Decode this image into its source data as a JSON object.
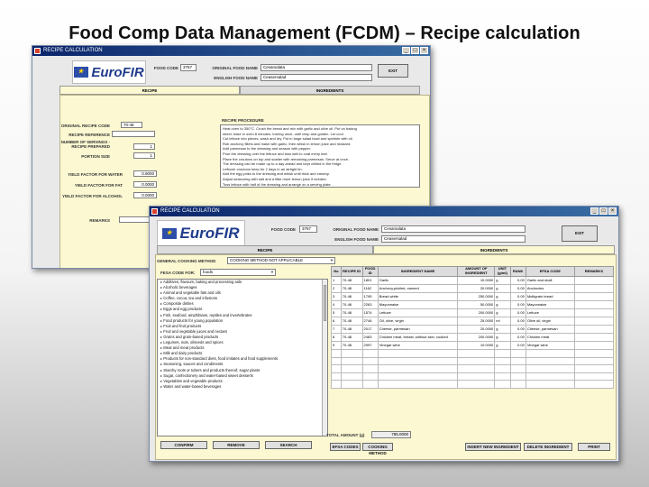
{
  "slide": {
    "title": "Food Comp Data Management (FCDM) – Recipe calculation"
  },
  "logo": {
    "text": "EuroFIR"
  },
  "back_window": {
    "title": "RECIPE CALCULATION",
    "food_code_label": "FOOD CODE",
    "food_code": "3767",
    "original_food_name_label": "ORIGINAL FOOD NAME",
    "original_food_name": "Cesarsalata",
    "english_food_name_label": "ENGLISH FOOD NAME",
    "english_food_name": "Ceasersalad",
    "exit_label": "EXIT",
    "tabs": [
      "RECIPE",
      "INGREDIENTS"
    ],
    "fields": [
      {
        "label": "ORIGINAL RECIPE CODE",
        "value": "70-48"
      },
      {
        "label": "RECIPE REFERENCE",
        "value": ""
      },
      {
        "label": "NUMBER OF SERVINGS - RECIPE PREPARED",
        "value": "1"
      },
      {
        "label": "PORTION SIZE",
        "value": "1"
      },
      {
        "label": "YIELD FACTOR FOR WATER",
        "value": "0.9000"
      },
      {
        "label": "YIELD FACTOR FOR FAT",
        "value": "0.0000"
      },
      {
        "label": "YIELD FACTOR FOR ALCOHOL",
        "value": "0.0000"
      },
      {
        "label": "REMARKS",
        "value": ""
      }
    ],
    "recipe_procedure_label": "RECIPE PROCEDURE",
    "recipe_procedure_lines": [
      "Heat oven to 350°C. Crush the bread and mix with garlic and olive oil. Put on baking",
      "sheet, bake in oven 8 minutes, turning once, until crisp and golden. Let cool.",
      "Cut lettuce into pieces, wash and dry. Put in large salad bowl and sprinkle with oil.",
      "Rub anchovy fillets and mash with garlic, then whisk in lemon juice and mustard.",
      "Add parmesan to the dressing and season with pepper.",
      "Pour the dressing over the lettuce and toss well to coat every leaf.",
      "Place the croutons on top and scatter with remaining parmesan. Serve at once.",
      "The dressing can be made up to a day ahead and kept chilled in the fridge.",
      "Leftover croutons keep for 2 days in an airtight tin.",
      "Add the egg yolks to the dressing and whisk until thick and creamy.",
      "Adjust seasoning with salt and a little more lemon juice if needed.",
      "Toss lettuce with half of the dressing and arrange on a serving plate."
    ]
  },
  "front_window": {
    "title": "RECIPE CALCULATION",
    "food_code_label": "FOOD CODE",
    "food_code": "3767",
    "original_food_name_label": "ORIGINAL FOOD NAME",
    "original_food_name": "Cesarsalata",
    "english_food_name_label": "ENGLISH FOOD NAME",
    "english_food_name": "Ceasersalad",
    "exit_label": "EXIT",
    "tabs": [
      "RECIPE",
      "INGREDIENTS"
    ],
    "general_cooking_method_label": "GENERAL COOKING METHOD",
    "general_cooking_method_value": "COOKING METHOD NOT APPLICABLE",
    "fesa_code_label": "FESA CODE FOR:",
    "fesa_code_value": "foods",
    "categories": [
      "Additives, flavours, baking and processing aids",
      "Alcoholic beverages",
      "Animal and vegetable fats and oils",
      "Coffee, cocoa, tea and infusions",
      "Composite dishes",
      "Eggs and egg products",
      "Fish, seafood, amphibians, reptiles and invertebrates",
      "Food products for young population",
      "Fruit and fruit products",
      "Fruit and vegetable juices and nectars",
      "Grains and grain-based products",
      "Legumes, nuts, oilseeds and spices",
      "Meat and meat products",
      "Milk and dairy products",
      "Products for non-standard diets, food imitates and food supplements",
      "Seasoning, sauces and condiments",
      "Starchy roots or tubers and products thereof, sugar plants",
      "Sugar, confectionery and water-based sweet desserts",
      "Vegetables and vegetable products",
      "Water and water-based beverages"
    ],
    "table_headers": [
      "No",
      "RECIPE ID",
      "FOOD ID",
      "INGREDIENT NAME",
      "AMOUNT OF INGREDIENT",
      "UNIT (g/ml)",
      "RANK",
      "EFSA CODE",
      "REMARKS"
    ],
    "ingredients": [
      [
        "1",
        "70-48",
        "1801",
        "Garlic",
        "10.0000",
        "g",
        "0.00",
        "Garlic and shall",
        ""
      ],
      [
        "2",
        "70-48",
        "1162",
        "Anchovy,pickled, canned",
        "20.0000",
        "g",
        "0.00",
        "Anchovies",
        ""
      ],
      [
        "3",
        "70-48",
        "1795",
        "Bread white",
        "250.0000",
        "g",
        "0.00",
        "Multigrain bread",
        ""
      ],
      [
        "4",
        "70-48",
        "2263",
        "Mayonnaise",
        "50.0000",
        "g",
        "0.00",
        "Mayonnaise",
        ""
      ],
      [
        "5",
        "70-48",
        "1574",
        "Lettuce",
        "200.0000",
        "g",
        "0.00",
        "Lettuce",
        ""
      ],
      [
        "6",
        "70-48",
        "2746",
        "Oil, olive, virgin",
        "25.0000",
        "ml",
        "0.00",
        "Olive oil, virgin",
        ""
      ],
      [
        "7",
        "70-48",
        "2017",
        "Cheese, parmesan",
        "20.0000",
        "g",
        "0.00",
        "Cheese, parmesan",
        ""
      ],
      [
        "8",
        "70-48",
        "2483",
        "Chicken meat, breast, without skin, cooked",
        "200.0000",
        "g",
        "0.00",
        "Chicken meat",
        ""
      ],
      [
        "9",
        "70-48",
        "2997",
        "Vinegar wine",
        "10.0000",
        "g",
        "0.00",
        "Vinegar wine",
        ""
      ]
    ],
    "total_amount_label": "TOTAL AMOUNT (g)",
    "total_amount_value": "785.0000",
    "buttons": {
      "confirm": "CONFIRM",
      "remove": "REMOVE",
      "search": "SEARCH",
      "efsa_codes": "EFSA CODES",
      "cooking_method": "COOKING METHOD",
      "insert_new_ingredient": "INSERT NEW INGREDIENT",
      "delete_ingredient": "DELETE INGREDIENT",
      "print": "PRINT"
    }
  },
  "colors": {
    "titlebar": "#0a246a",
    "panel": "#fbf8d2",
    "logo_blue": "#1f3b8a"
  }
}
